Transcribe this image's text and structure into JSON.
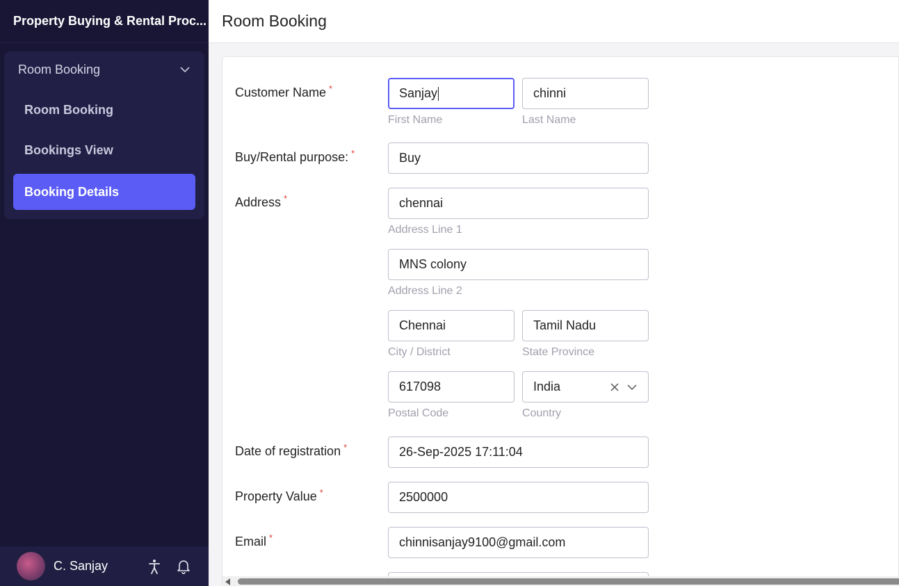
{
  "app": {
    "title": "Property Buying & Rental Proc..."
  },
  "sidebar": {
    "group_label": "Room Booking",
    "items": [
      {
        "label": "Room Booking",
        "active": false
      },
      {
        "label": "Bookings View",
        "active": false
      },
      {
        "label": "Booking Details",
        "active": true
      }
    ],
    "accent_color": "#5b5cf6"
  },
  "user": {
    "name": "C. Sanjay"
  },
  "header": {
    "title": "Room Booking"
  },
  "form": {
    "customer_name": {
      "label": "Customer Name",
      "first_name": "Sanjay",
      "first_name_hint": "First Name",
      "last_name": "chinni",
      "last_name_hint": "Last Name"
    },
    "purpose": {
      "label": "Buy/Rental purpose:",
      "value": "Buy"
    },
    "address": {
      "label": "Address",
      "line1": "chennai",
      "line1_hint": "Address Line 1",
      "line2": "MNS colony",
      "line2_hint": "Address Line 2",
      "city": "Chennai",
      "city_hint": "City / District",
      "state": "Tamil Nadu",
      "state_hint": "State Province",
      "postal": "617098",
      "postal_hint": "Postal Code",
      "country": "India",
      "country_hint": "Country"
    },
    "date_of_registration": {
      "label": "Date of registration",
      "value": "26-Sep-2025 17:11:04"
    },
    "property_value": {
      "label": "Property Value",
      "value": "2500000"
    },
    "email": {
      "label": "Email",
      "value": "chinnisanjay9100@gmail.com"
    },
    "required_mark": "*"
  }
}
